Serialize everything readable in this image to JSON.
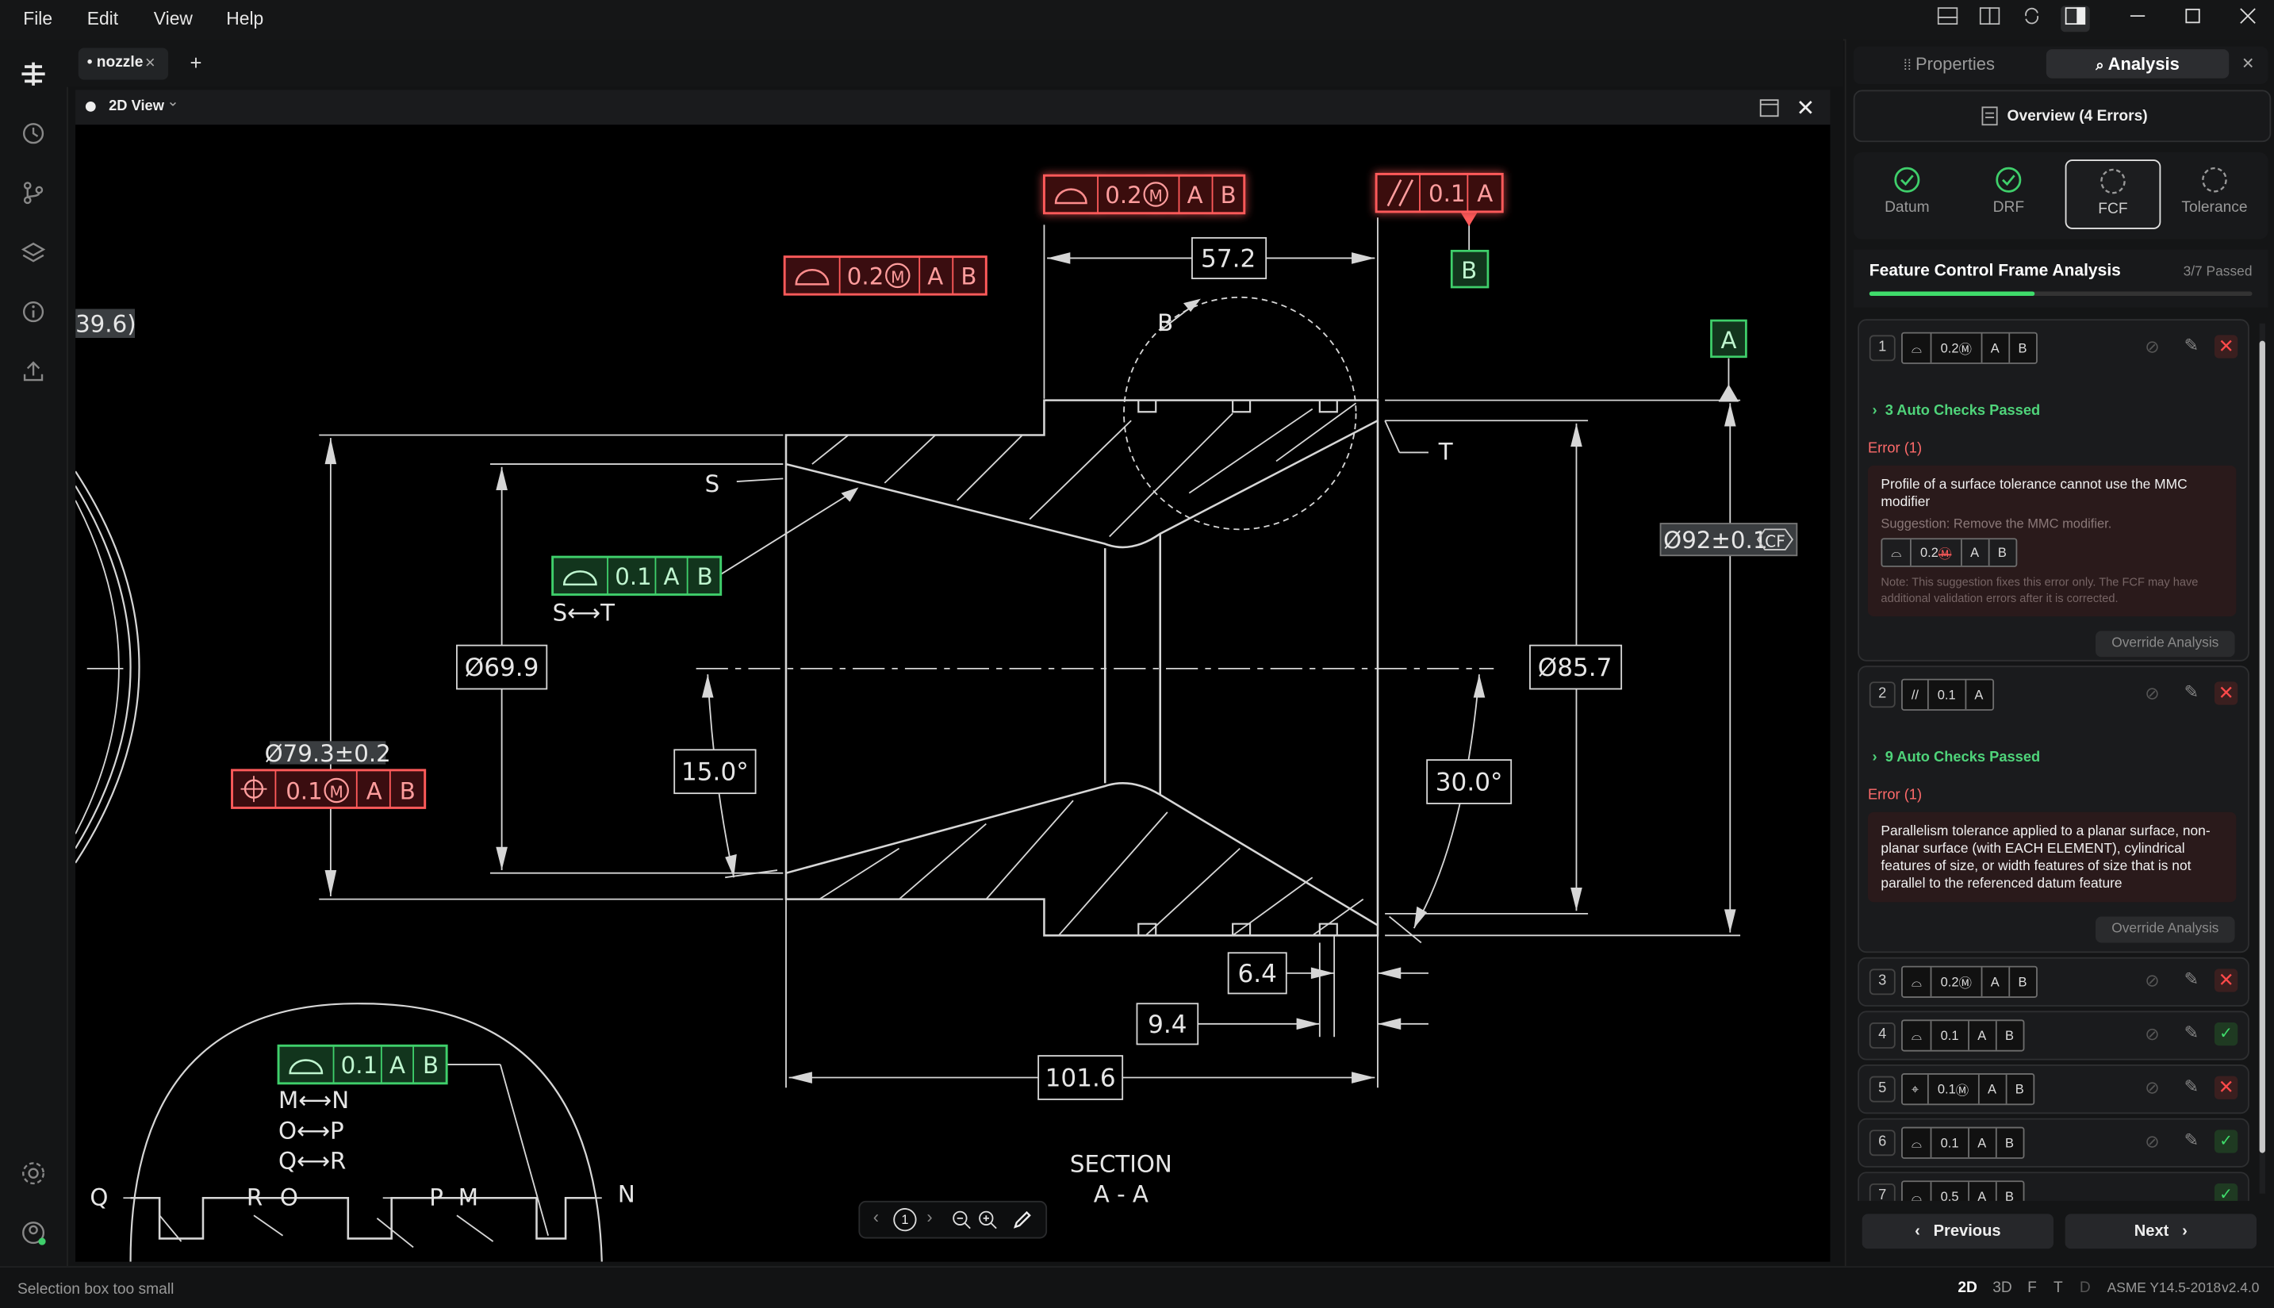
{
  "menu": {
    "file": "File",
    "edit": "Edit",
    "view": "View",
    "help": "Help"
  },
  "tabs": {
    "doc": "• nozzle",
    "close": "×",
    "add": "+"
  },
  "view": {
    "title": "2D View",
    "caret": "⌄"
  },
  "drawing": {
    "dim_57": "57.2",
    "dim_39": "39.6)",
    "dim_79": "Ø79.3±0.2",
    "dim_69": "Ø69.9",
    "dim_15": "15.0°",
    "dim_857": "Ø85.7",
    "dim_30": "30.0°",
    "dim_92": "Ø92±0.1",
    "dim_cf": "CF",
    "dim_64": "6.4",
    "dim_94": "9.4",
    "dim_1016": "101.6",
    "lbl_B": "B",
    "lbl_T": "T",
    "lbl_S": "S",
    "lbl_A": "A",
    "datum_B": "B",
    "datum_A": "A",
    "st": "S⟷T",
    "mn": "M⟷N",
    "op": "O⟷P",
    "qr": "Q⟷R",
    "q": "Q",
    "r": "R",
    "o": "O",
    "p": "P",
    "m": "M",
    "n": "N",
    "section1": "SECTION",
    "section2": "A - A",
    "fcf_top1_tol": "0.2",
    "fcf_top1_a": "A",
    "fcf_top1_b": "B",
    "fcf_top2_tol": "0.1",
    "fcf_top2_a": "A",
    "fcf_left_tol": "0.2",
    "fcf_left_a": "A",
    "fcf_left_b": "B",
    "fcf_green1_tol": "0.1",
    "fcf_green1_a": "A",
    "fcf_green1_b": "B",
    "fcf_pos_tol": "0.1",
    "fcf_pos_a": "A",
    "fcf_pos_b": "B",
    "fcf_green2_tol": "0.1",
    "fcf_green2_a": "A",
    "fcf_green2_b": "B",
    "page": "1"
  },
  "panel": {
    "tab_properties": "Properties",
    "tab_analysis": "Analysis",
    "overview": "Overview (4 Errors)",
    "steps": [
      "Datum",
      "DRF",
      "FCF",
      "Tolerance"
    ],
    "fcf_title": "Feature Control Frame Analysis",
    "fcf_passed": "3/7 Passed",
    "progress": 0.43,
    "items": [
      {
        "n": "1",
        "tol": "0.2",
        "mod": "Ⓜ",
        "a": "A",
        "b": "B",
        "checks": "3 Auto Checks Passed",
        "error_label": "Error (1)",
        "error": "Profile of a surface tolerance cannot use the MMC modifier",
        "suggestion": "Suggestion: Remove the MMC modifier.",
        "note": "Note: This suggestion fixes this error only. The FCF may have additional validation errors after it is corrected.",
        "override": "Override Analysis"
      },
      {
        "n": "2",
        "sym": "//",
        "tol": "0.1",
        "a": "A",
        "checks": "9 Auto Checks Passed",
        "error_label": "Error (1)",
        "error": "Parallelism tolerance applied to a planar surface, non-planar surface (with EACH ELEMENT), cylindrical features of size, or width features of size that is not parallel to the referenced datum feature",
        "override": "Override Analysis"
      },
      {
        "n": "3",
        "tol": "0.2",
        "mod": "Ⓜ",
        "a": "A",
        "b": "B"
      },
      {
        "n": "4",
        "tol": "0.1",
        "a": "A",
        "b": "B"
      },
      {
        "n": "5",
        "tol": "0.1",
        "mod": "Ⓜ",
        "a": "A",
        "b": "B"
      },
      {
        "n": "6",
        "tol": "0.1",
        "a": "A",
        "b": "B"
      },
      {
        "n": "7",
        "tol": "0.5",
        "a": "A",
        "b": "B"
      }
    ],
    "suggest_tol": "0.2",
    "prev": "Previous",
    "next": "Next"
  },
  "status": {
    "message": "Selection box too small",
    "m2d": "2D",
    "m3d": "3D",
    "mf": "F",
    "mt": "T",
    "md": "D",
    "standard": "ASME Y14.5-2018",
    "version": "v2.4.0"
  },
  "colors": {
    "error": "#ff5a5a",
    "pass": "#3fcf6b",
    "accent": "#3fdc6b"
  }
}
